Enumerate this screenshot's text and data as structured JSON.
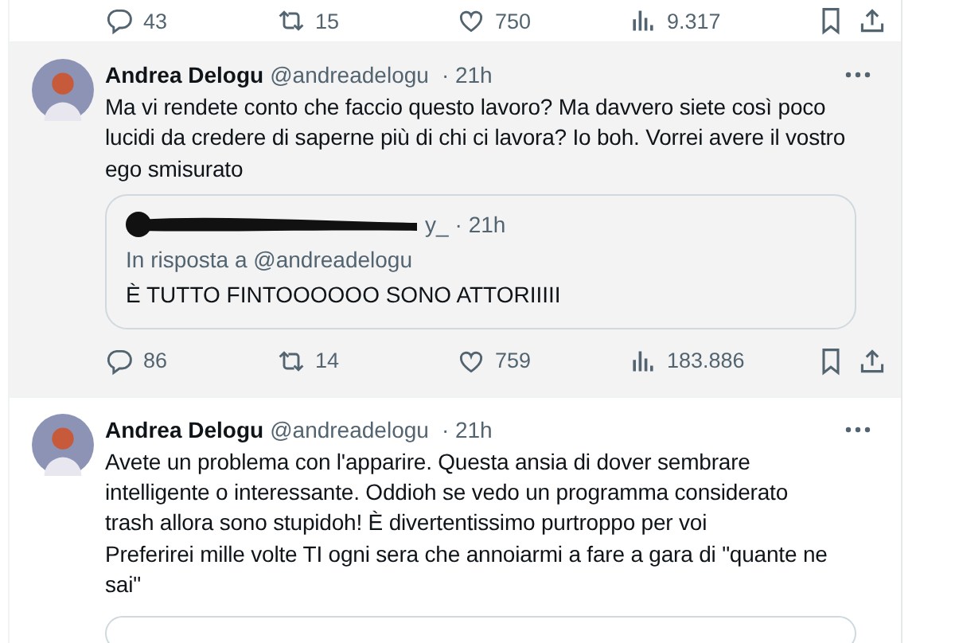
{
  "top_actions": [
    {
      "kind": "reply",
      "count": "43"
    },
    {
      "kind": "retweet",
      "count": "15"
    },
    {
      "kind": "like",
      "count": "750"
    },
    {
      "kind": "views",
      "count": "9.317"
    },
    {
      "kind": "bookmark"
    },
    {
      "kind": "share"
    }
  ],
  "tweets": [
    {
      "name": "Andrea Delogu",
      "handle": "@andreadelogu",
      "time": "· 21h",
      "hovered": true,
      "text": "Ma vi rendete conto che faccio questo lavoro? Ma davvero siete così poco\nlucidi da credere di saperne più di chi ci lavora? Io boh. Vorrei avere il vostro\nego smisurato",
      "quote": {
        "handle_visible": "y_",
        "time": "· 21h",
        "reply_to": "In risposta a @andreadelogu",
        "text": "È TUTTO FINTOOOOOO SONO ATTORIIIII"
      },
      "actions": [
        {
          "kind": "reply",
          "count": "86"
        },
        {
          "kind": "retweet",
          "count": "14"
        },
        {
          "kind": "like",
          "count": "759"
        },
        {
          "kind": "views",
          "count": "183.886"
        },
        {
          "kind": "bookmark"
        },
        {
          "kind": "share"
        }
      ]
    },
    {
      "name": "Andrea Delogu",
      "handle": "@andreadelogu",
      "time": "· 21h",
      "hovered": false,
      "text": "Avete un problema con l'apparire. Questa ansia di dover sembrare\nintelligente o interessante. Oddioh se vedo un programma considerato\ntrash allora sono stupidoh! È divertentissimo purtroppo per voi\nPreferirei mille volte TI ogni sera che annoiarmi a fare a gara di \"quante ne\nsai\"",
      "quote_cut": true
    }
  ]
}
